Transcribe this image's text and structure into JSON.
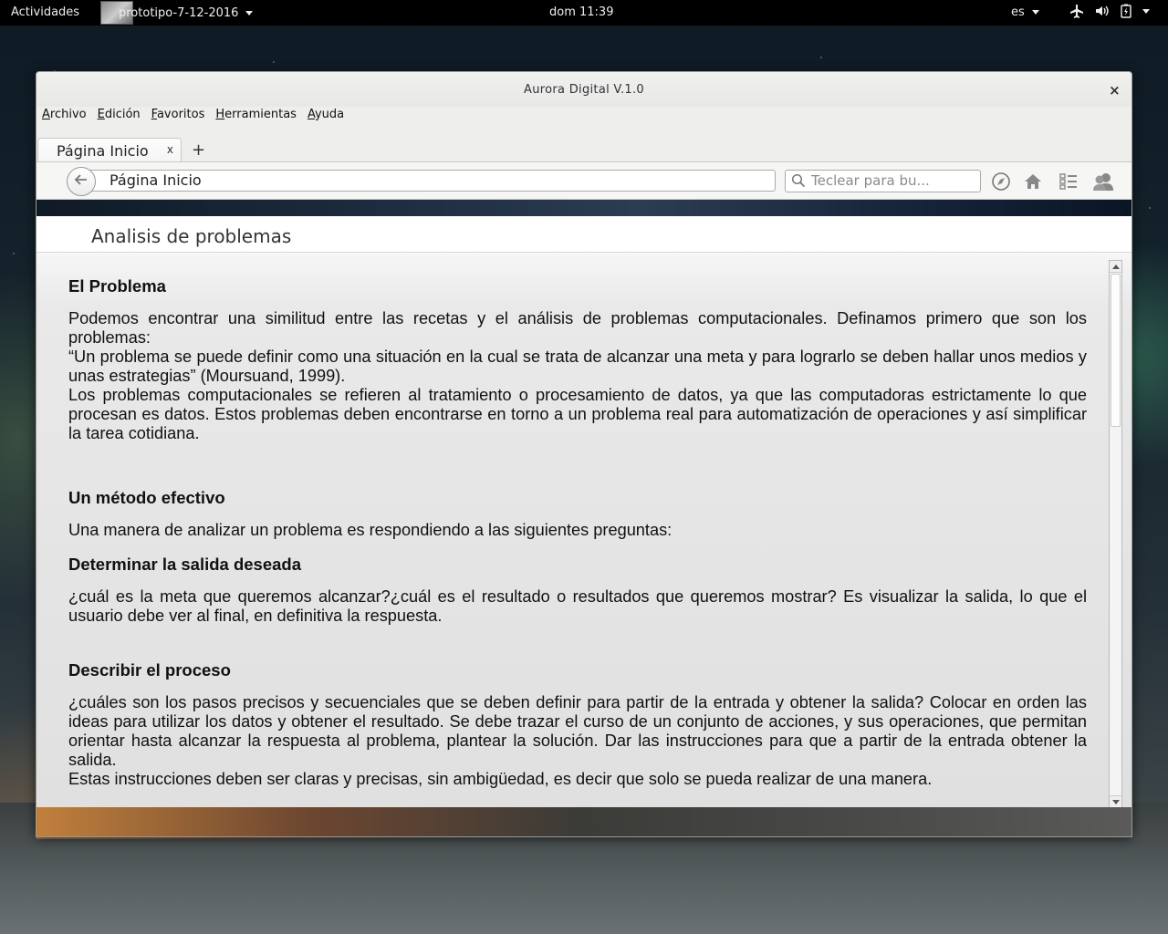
{
  "topbar": {
    "activities": "Actividades",
    "app_name": "prototipo-7-12-2016",
    "clock": "dom 11:39",
    "language": "es",
    "status_icons": [
      "airplane-icon",
      "volume-icon",
      "battery-icon",
      "power-menu-icon"
    ]
  },
  "window": {
    "title": "Aurora Digital V.1.0",
    "close_label": "×"
  },
  "menubar": {
    "items": [
      {
        "mnemonic": "A",
        "rest": "rchivo"
      },
      {
        "mnemonic": "E",
        "rest": "dición"
      },
      {
        "mnemonic": "F",
        "rest": "avoritos"
      },
      {
        "mnemonic": "H",
        "rest": "erramientas"
      },
      {
        "mnemonic": "A",
        "rest": "yuda"
      }
    ]
  },
  "tabs": {
    "active_label": "Página Inicio",
    "close_label": "x",
    "new_tab_label": "+"
  },
  "navbar": {
    "url_value": "Página Inicio",
    "search_placeholder": "Teclear para bu...",
    "icons": [
      "back-arrow-icon",
      "compass-icon",
      "home-icon",
      "list-icon",
      "users-icon"
    ]
  },
  "page": {
    "header_title": "Analisis de problemas",
    "sections": {
      "s1_title": "El Problema",
      "s1_p1": "Podemos encontrar una similitud entre las recetas y el análisis de problemas computacionales. Definamos primero que son los problemas:",
      "s1_p2": "“Un problema se puede definir como una situación en la cual se trata de alcanzar una meta y para lograrlo se deben hallar unos medios y unas estrategias” (Moursuand, 1999).",
      "s1_p3": "Los problemas computacionales se refieren al tratamiento o procesamiento de datos, ya que las computadoras estrictamente lo que procesan es datos. Estos problemas deben encontrarse en torno a un problema real para automatización de operaciones y así simplificar la tarea cotidiana.",
      "s2_title": "Un método efectivo",
      "s2_p1": "Una manera de analizar un problema es respondiendo a las siguientes preguntas:",
      "s3_title": "Determinar la salida deseada",
      "s3_p1": "¿cuál es la meta que queremos alcanzar?¿cuál es el resultado o resultados  que queremos mostrar?  Es visualizar la salida, lo que el usuario debe ver al final, en definitiva la respuesta.",
      "s4_title": "Describir el proceso",
      "s4_p1": "¿cuáles son los pasos precisos y secuenciales que se deben definir para partir de la entrada y obtener la salida? Colocar en orden las ideas para utilizar los datos y obtener el resultado. Se debe trazar el curso de un conjunto de acciones, y sus operaciones, que permitan orientar hasta alcanzar la respuesta al problema, plantear la solución. Dar las instrucciones para que a partir de la entrada obtener la salida.",
      "s4_p2": "Estas instrucciones deben ser claras y  precisas, sin ambigüedad, es decir que solo se pueda realizar de una manera."
    }
  }
}
